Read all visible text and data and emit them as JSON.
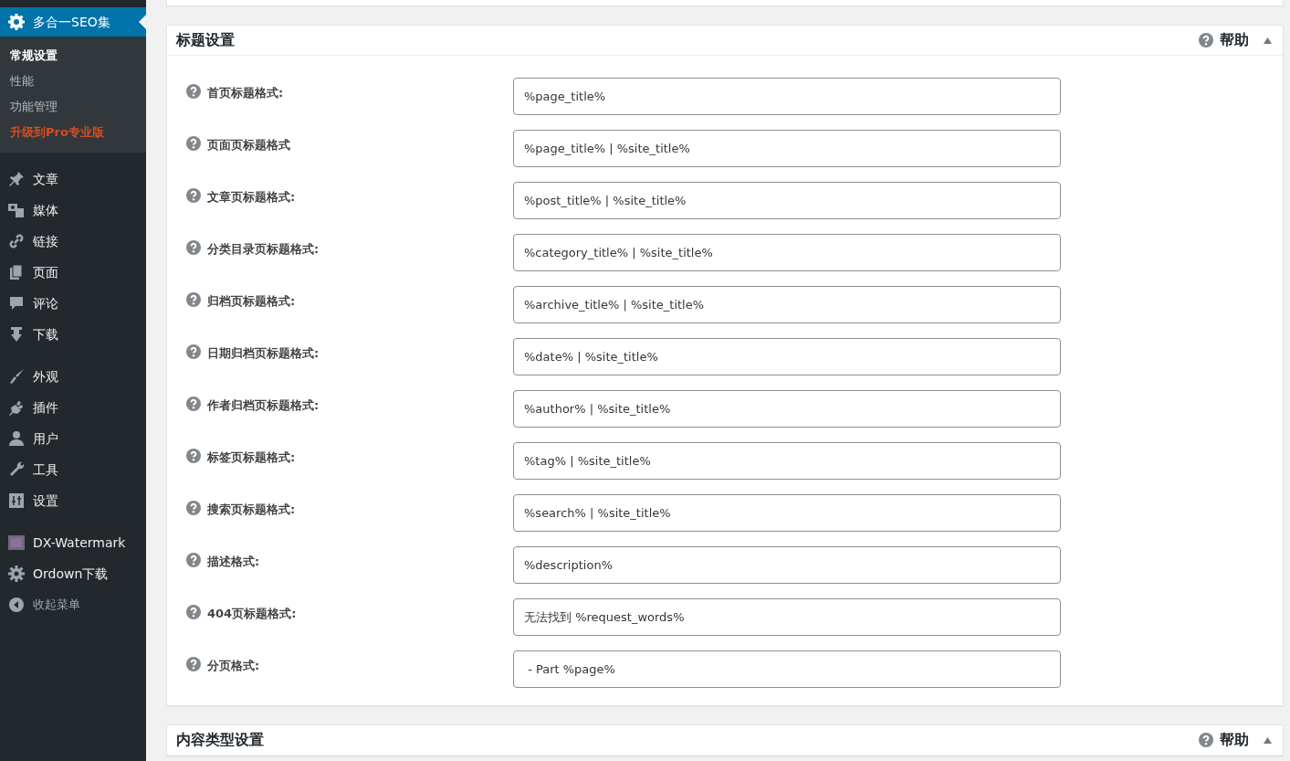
{
  "sidebar": {
    "active_item": {
      "label": "多合一SEO集"
    },
    "submenu": [
      {
        "label": "常规设置",
        "selected": true,
        "kind": "link"
      },
      {
        "label": "性能",
        "selected": false,
        "kind": "link"
      },
      {
        "label": "功能管理",
        "selected": false,
        "kind": "link"
      },
      {
        "label": "升级到Pro专业版",
        "selected": false,
        "kind": "upgrade"
      }
    ],
    "menu_groups": [
      [
        {
          "label": "文章",
          "kind": "item"
        },
        {
          "label": "媒体",
          "kind": "item"
        },
        {
          "label": "链接",
          "kind": "item"
        },
        {
          "label": "页面",
          "kind": "item"
        },
        {
          "label": "评论",
          "kind": "item"
        },
        {
          "label": "下载",
          "kind": "item"
        }
      ],
      [
        {
          "label": "外观",
          "kind": "item"
        },
        {
          "label": "插件",
          "kind": "item"
        },
        {
          "label": "用户",
          "kind": "item"
        },
        {
          "label": "工具",
          "kind": "item"
        },
        {
          "label": "设置",
          "kind": "item"
        }
      ],
      [
        {
          "label": "DX-Watermark",
          "kind": "item"
        },
        {
          "label": "Ordown下载",
          "kind": "item"
        },
        {
          "label": "收起菜单",
          "kind": "collapse"
        }
      ]
    ]
  },
  "panels": [
    {
      "title": "标题设置",
      "help_label": "帮助",
      "expanded": true,
      "fields": [
        {
          "label": "首页标题格式:",
          "value": "%page_title%"
        },
        {
          "label": "页面页标题格式",
          "value": "%page_title% | %site_title%"
        },
        {
          "label": "文章页标题格式:",
          "value": "%post_title% | %site_title%"
        },
        {
          "label": "分类目录页标题格式:",
          "value": "%category_title% | %site_title%"
        },
        {
          "label": "归档页标题格式:",
          "value": "%archive_title% | %site_title%"
        },
        {
          "label": "日期归档页标题格式:",
          "value": "%date% | %site_title%"
        },
        {
          "label": "作者归档页标题格式:",
          "value": "%author% | %site_title%"
        },
        {
          "label": "标签页标题格式:",
          "value": "%tag% | %site_title%"
        },
        {
          "label": "搜索页标题格式:",
          "value": "%search% | %site_title%"
        },
        {
          "label": "描述格式:",
          "value": "%description%"
        },
        {
          "label": "404页标题格式:",
          "value": "无法找到 %request_words%"
        },
        {
          "label": "分页格式:",
          "value": " - Part %page%"
        }
      ]
    },
    {
      "title": "内容类型设置",
      "help_label": "帮助",
      "expanded": true
    }
  ]
}
